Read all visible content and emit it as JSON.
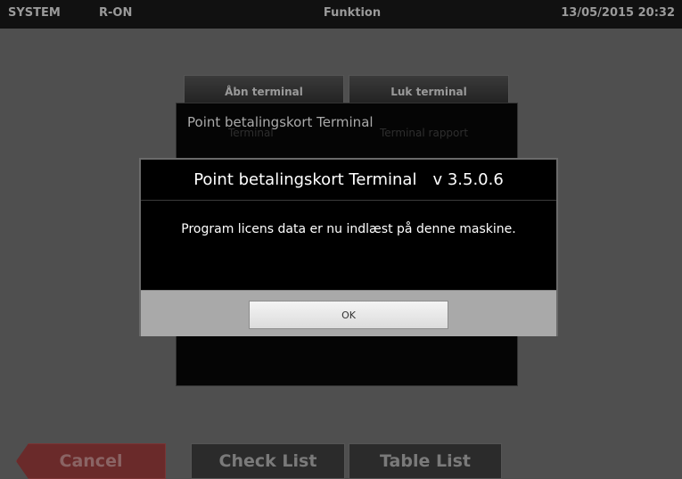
{
  "topbar": {
    "system": "SYSTEM",
    "mode": "R-ON",
    "title": "Funktion",
    "datetime": "13/05/2015 20:32"
  },
  "functions": {
    "open_terminal": "Åbn terminal",
    "close_terminal": "Luk terminal"
  },
  "terminal_panel": {
    "title": "Point betalingskort Terminal",
    "ghost_left": "Terminal",
    "ghost_right": "Terminal rapport"
  },
  "dialog": {
    "title": "Point betalingskort Terminal",
    "version": "v 3.5.0.6",
    "message": "Program licens data er nu indlæst på denne maskine.",
    "ok_label": "OK"
  },
  "bottom": {
    "cancel": "Cancel",
    "check_list": "Check List",
    "table_list": "Table List"
  },
  "colors": {
    "background": "#4f4f4f",
    "topbar": "#111111",
    "dialog": "#000000",
    "footer": "#a9a9a9",
    "cancel": "#6a2a2a"
  }
}
